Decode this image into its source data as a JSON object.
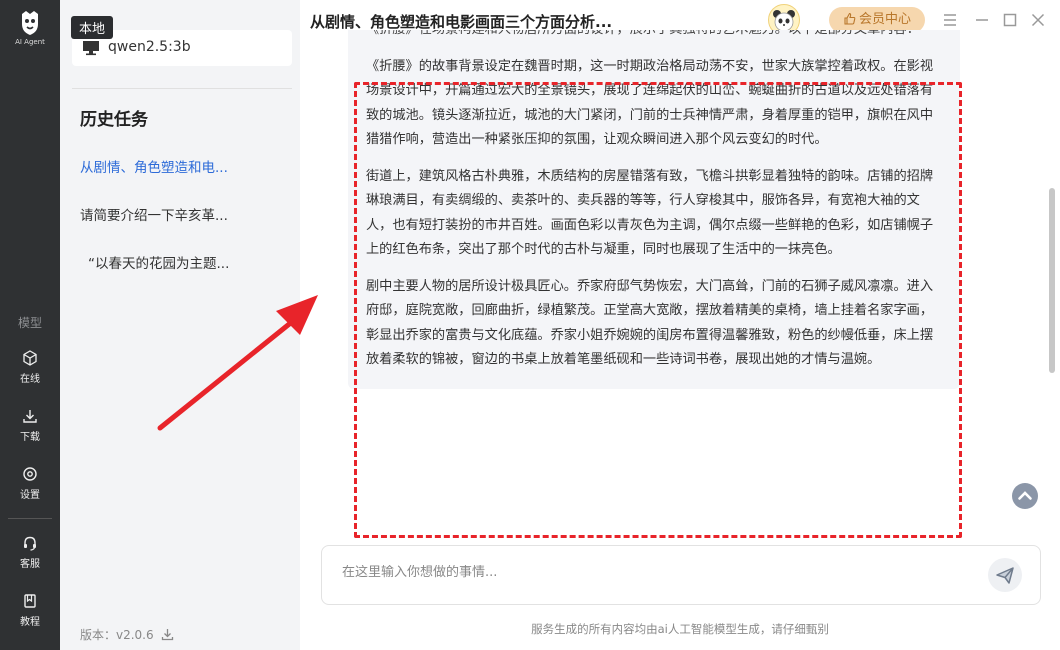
{
  "app": {
    "logo_text": "AI Agent"
  },
  "rail": {
    "section_label": "模型",
    "items": [
      {
        "label": "在线",
        "icon": "cube-icon"
      },
      {
        "label": "下载",
        "icon": "download-icon"
      },
      {
        "label": "设置",
        "icon": "gear-icon"
      },
      {
        "label": "客服",
        "icon": "headset-icon"
      },
      {
        "label": "教程",
        "icon": "book-icon"
      }
    ]
  },
  "sidebar": {
    "badge": "本地",
    "model_name": "qwen2.5:3b",
    "history_title": "历史任务",
    "history": [
      {
        "label": "从剧情、角色塑造和电...",
        "active": true
      },
      {
        "label": "请简要介绍一下辛亥革...",
        "active": false
      },
      {
        "label": "“以春天的花园为主题...",
        "active": false
      }
    ],
    "version": "版本：v2.0.6"
  },
  "header": {
    "title": "从剧情、角色塑造和电影画面三个方面分析...",
    "vip_label": "会员中心"
  },
  "content": {
    "intro": "《折腰》在场景构建和人物居所方面的设计，展示了其独特的艺术魅力。以下是部分文章内容：",
    "paragraphs": [
      "《折腰》的故事背景设定在魏晋时期，这一时期政治格局动荡不安，世家大族掌控着政权。在影视场景设计中，开篇通过宏大的全景镜头，展现了连绵起伏的山峦、蜿蜒曲折的古道以及远处错落有致的城池。镜头逐渐拉近，城池的大门紧闭，门前的士兵神情严肃，身着厚重的铠甲，旗帜在风中猎猎作响，营造出一种紧张压抑的氛围，让观众瞬间进入那个风云变幻的时代。",
      "街道上，建筑风格古朴典雅，木质结构的房屋错落有致，飞檐斗拱彰显着独特的韵味。店铺的招牌琳琅满目，有卖绸缎的、卖茶叶的、卖兵器的等等，行人穿梭其中，服饰各异，有宽袍大袖的文人，也有短打装扮的市井百姓。画面色彩以青灰色为主调，偶尔点缀一些鲜艳的色彩，如店铺幌子上的红色布条，突出了那个时代的古朴与凝重，同时也展现了生活中的一抹亮色。",
      "剧中主要人物的居所设计极具匠心。乔家府邸气势恢宏，大门高耸，门前的石狮子威风凛凛。进入府邸，庭院宽敞，回廊曲折，绿植繁茂。正堂高大宽敞，摆放着精美的桌椅，墙上挂着名家字画，彰显出乔家的富贵与文化底蕴。乔家小姐乔婉婉的闺房布置得温馨雅致，粉色的纱幔低垂，床上摆放着柔软的锦被，窗边的书桌上放着笔墨纸砚和一些诗词书卷，展现出她的才情与温婉。"
    ]
  },
  "input": {
    "placeholder": "在这里输入你想做的事情..."
  },
  "footer": {
    "note": "服务生成的所有内容均由ai人工智能模型生成，请仔细甄别"
  },
  "colors": {
    "accent": "#2d6bd8",
    "highlight": "#e8242a",
    "rail_bg": "#2f3133",
    "vip_bg": "#f6d7ae"
  }
}
